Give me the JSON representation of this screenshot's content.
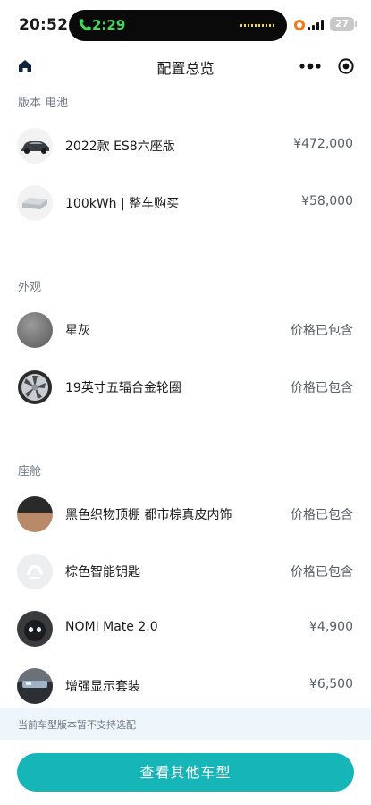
{
  "status_bar": {
    "time": "20:52",
    "call_time": "2:29",
    "battery": "27",
    "icons": [
      "phone-icon",
      "recording-dot-icon",
      "signal-icon",
      "battery-icon"
    ]
  },
  "nav": {
    "title": "配置总览",
    "icons": [
      "home-icon",
      "more-icon",
      "target-icon"
    ]
  },
  "sections": [
    {
      "title": "版本 电池",
      "items": [
        {
          "label": "2022款 ES8六座版",
          "price": "¥472,000",
          "thumb": "car"
        },
        {
          "label": "100kWh | 整车购买",
          "price": "¥58,000",
          "thumb": "battery-pack"
        }
      ]
    },
    {
      "title": "外观",
      "items": [
        {
          "label": "星灰",
          "price": "价格已包含",
          "thumb": "paint-swatch"
        },
        {
          "label": "19英寸五辐合金轮圈",
          "price": "价格已包含",
          "thumb": "wheel"
        }
      ]
    },
    {
      "title": "座舱",
      "items": [
        {
          "label": "黑色织物顶棚 都市棕真皮内饰",
          "price": "价格已包含",
          "thumb": "interior-swatch"
        },
        {
          "label": "棕色智能钥匙",
          "price": "价格已包含",
          "thumb": "key"
        },
        {
          "label": "NOMI Mate 2.0",
          "price": "¥4,900",
          "thumb": "nomi"
        },
        {
          "label": "增强显示套装",
          "price": "¥6,500",
          "thumb": "display"
        }
      ]
    }
  ],
  "notice": "当前车型版本暂不支持选配",
  "cta_label": "查看其他车型",
  "colors": {
    "accent": "#16b6b8",
    "notice_bg": "#eef6fb",
    "call_green": "#3ddc5a",
    "recording_orange": "#f07a1a"
  }
}
